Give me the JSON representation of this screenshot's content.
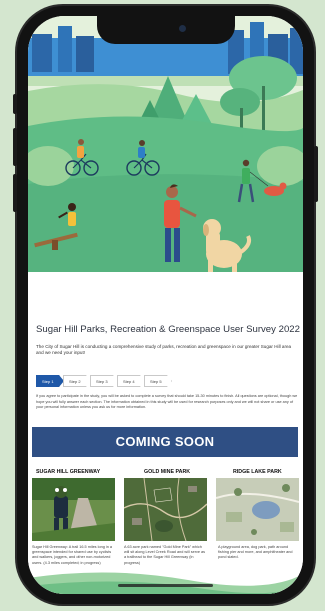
{
  "survey": {
    "title": "Sugar Hill Parks, Recreation & Greenspace User Survey 2022",
    "intro": "The City of Sugar Hill is conducting a comprehensive study of parks, recreation and greenspace in our greater Sugar Hill area and we need your input!",
    "consent": "If you agree to participate in the study, you will be asked to complete a survey that should take 15-30 minutes to finish. All questions are optional, though we hope you will fully answer each section. The information obtained in this study will be used for research purposes only and we will not share or use any of your personal information unless you ask us for more information."
  },
  "steps": [
    "Step 1",
    "Step 2",
    "Step 3",
    "Step 4",
    "Step 5"
  ],
  "coming_soon": "COMING SOON",
  "parks": [
    {
      "title": "SUGAR HILL GREENWAY",
      "description": "Sugar Hill Greenway: A trail 16.5 miles long in a greenspace intended for shared use by cyclists and walkers, joggers, and other non-motorized users. (4.3 miles completed; in progress)"
    },
    {
      "title": "GOLD MINE PARK",
      "description": "A 63 acre park named \"Gold Mine Park\" which will sit along Level Creek Road and will serve as a trailhead to the Sugar Hill Greenway (in progress)"
    },
    {
      "title": "RIDGE LAKE PARK",
      "description": "A playground area, dog park, path around fishing pier and more, and amphitheater and pond slated."
    }
  ],
  "colors": {
    "background": "#d4e6cf",
    "accent_blue": "#1f58a8",
    "banner_blue": "#2f4f84",
    "hero_green": "#5cbf8a"
  }
}
